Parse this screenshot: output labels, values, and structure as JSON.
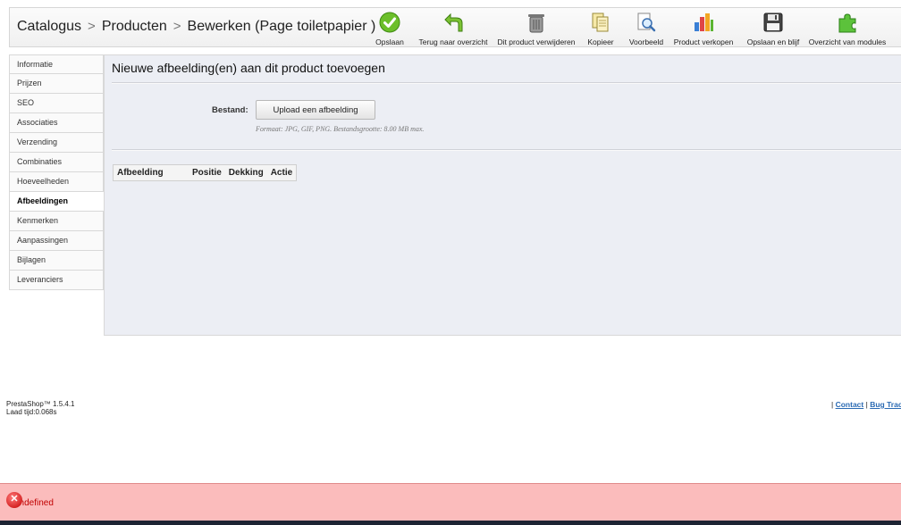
{
  "breadcrumb": {
    "items": [
      "Catalogus",
      "Producten",
      "Bewerken (Page toiletpapier )"
    ],
    "separator": ">"
  },
  "toolbar": {
    "buttons": [
      {
        "label": "Opslaan",
        "icon": "check-icon"
      },
      {
        "label": "Terug naar overzicht",
        "icon": "back-arrow-icon"
      },
      {
        "label": "Dit product verwijderen",
        "icon": "trash-icon"
      },
      {
        "label": "Kopieer",
        "icon": "copy-icon"
      },
      {
        "label": "Voorbeeld",
        "icon": "preview-icon"
      },
      {
        "label": "Product verkopen",
        "icon": "stats-icon"
      },
      {
        "label": "Opslaan en blijf",
        "icon": "save-icon"
      },
      {
        "label": "Overzicht van modules",
        "icon": "puzzle-icon"
      }
    ]
  },
  "sidebar": {
    "items": [
      "Informatie",
      "Prijzen",
      "SEO",
      "Associaties",
      "Verzending",
      "Combinaties",
      "Hoeveelheden",
      "Afbeeldingen",
      "Kenmerken",
      "Aanpassingen",
      "Bijlagen",
      "Leveranciers"
    ],
    "active": "Afbeeldingen"
  },
  "main": {
    "title": "Nieuwe afbeelding(en) aan dit product toevoegen",
    "file_label": "Bestand:",
    "upload_button": "Upload een afbeelding",
    "hint": "Formaat: JPG, GIF, PNG. Bestandsgrootte: 8.00 MB max.",
    "table_headers": [
      "Afbeelding",
      "Positie",
      "Dekking",
      "Actie"
    ]
  },
  "footer": {
    "version": "PrestaShop™ 1.5.4.1",
    "load_time": "Laad tijd:0.068s",
    "sep": "|",
    "contact": "Contact",
    "bug_tracker": "Bug Tracker"
  },
  "error": {
    "message": "undefined",
    "icon": "error-icon"
  },
  "colors": {
    "error_bg": "#fbbcbc",
    "error_text": "#c00000",
    "link": "#2a6ab3",
    "panel_bg": "#eceef4"
  }
}
